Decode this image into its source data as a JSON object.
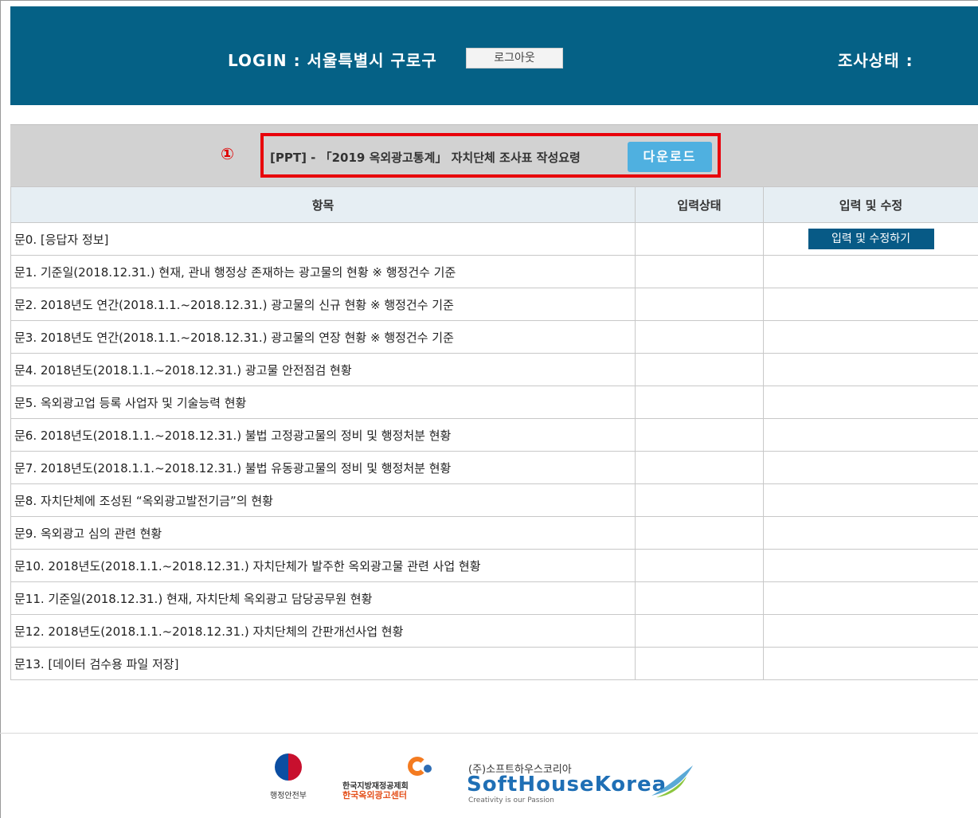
{
  "header": {
    "login_text": "LOGIN : 서울특별시 구로구",
    "logout_label": "로그아웃",
    "status_text": "조사상태 :"
  },
  "notice": {
    "number": "①",
    "text": "[PPT] - 「2019 옥외광고통계」 자치단체 조사표 작성요령",
    "download_label": "다운로드"
  },
  "table": {
    "headers": [
      "항목",
      "입력상태",
      "입력 및 수정"
    ],
    "edit_button_label": "입력 및 수정하기",
    "rows": [
      "문0. [응답자 정보]",
      "문1. 기준일(2018.12.31.) 현재, 관내 행정상 존재하는 광고물의 현황 ※ 행정건수 기준",
      "문2. 2018년도 연간(2018.1.1.~2018.12.31.) 광고물의 신규 현황 ※ 행정건수 기준",
      "문3. 2018년도 연간(2018.1.1.~2018.12.31.) 광고물의 연장 현황 ※ 행정건수 기준",
      "문4. 2018년도(2018.1.1.~2018.12.31.) 광고물 안전점검 현황",
      "문5. 옥외광고업 등록 사업자 및 기술능력 현황",
      "문6. 2018년도(2018.1.1.~2018.12.31.) 불법 고정광고물의 정비 및 행정처분 현황",
      "문7. 2018년도(2018.1.1.~2018.12.31.) 불법 유동광고물의 정비 및 행정처분 현황",
      "문8. 자치단체에 조성된 “옥외광고발전기금”의 현황",
      "문9. 옥외광고 심의 관련 현황",
      "문10. 2018년도(2018.1.1.~2018.12.31.) 자치단체가 발주한 옥외광고물 관련 사업 현황",
      "문11. 기준일(2018.12.31.) 현재, 자치단체 옥외광고 담당공무원 현황",
      "문12. 2018년도(2018.1.1.~2018.12.31.) 자치단체의 간판개선사업 현황",
      "문13. [데이터 검수용 파일 저장]"
    ]
  },
  "footer": {
    "logo1_caption": "행정안전부",
    "logo2_line1": "한국지방재정공제회",
    "logo2_line2": "한국옥외광고센터",
    "logo3_line1": "(주)소프트하우스코리아",
    "logo3_line2": "SoftHouseKorea",
    "logo3_line3": "Creativity is our Passion"
  }
}
